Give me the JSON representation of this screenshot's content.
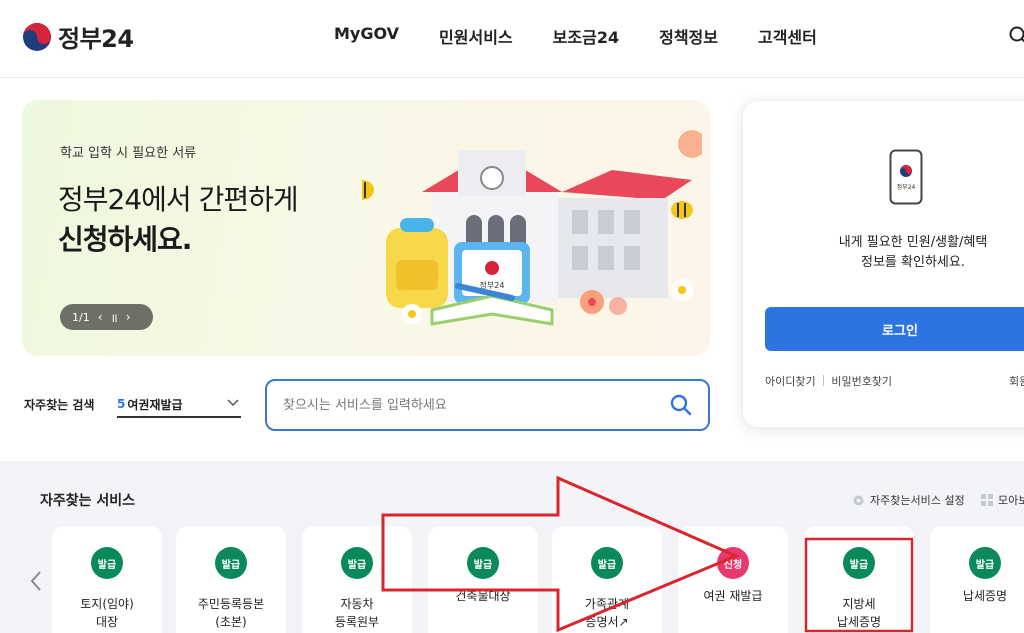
{
  "header": {
    "logo_text": "정부24",
    "nav": [
      "MyGOV",
      "민원서비스",
      "보조금24",
      "정책정보",
      "고객센터"
    ]
  },
  "banner": {
    "subtitle": "학교 입학 시 필요한 서류",
    "line1": "정부24에서 간편하게",
    "line2": "신청하세요.",
    "pager": "1/1",
    "tag_text": "정부24"
  },
  "login": {
    "badge_text": "정부24",
    "message_line1": "내게 필요한 민원/생활/혜택",
    "message_line2": "정보를 확인하세요.",
    "button": "로그인",
    "find_id": "아이디찾기",
    "find_pw": "비밀번호찾기",
    "join": "회원"
  },
  "search": {
    "quick_label": "자주찾는 검색",
    "quick_number": "5",
    "quick_value": "여권재발급",
    "placeholder": "찾으시는 서비스를 입력하세요"
  },
  "services": {
    "title": "자주찾는 서비스",
    "settings": "자주찾는서비스 설정",
    "view_all": "모아보",
    "items": [
      {
        "badge": "발급",
        "name1": "토지(임야)",
        "name2": "대장"
      },
      {
        "badge": "발급",
        "name1": "주민등록등본",
        "name2": "(초본)"
      },
      {
        "badge": "발급",
        "name1": "자동차",
        "name2": "등록원부"
      },
      {
        "badge": "발급",
        "name1": "건축물대장",
        "name2": ""
      },
      {
        "badge": "발급",
        "name1": "가족관계",
        "name2": "증명서↗"
      },
      {
        "badge": "신청",
        "name1": "여권 재발급",
        "name2": ""
      },
      {
        "badge": "발급",
        "name1": "지방세",
        "name2": "납세증명"
      },
      {
        "badge": "발급",
        "name1": "납세증명",
        "name2": ""
      }
    ]
  },
  "colors": {
    "accent_blue": "#2d74e0",
    "badge_green": "#0a8a5b",
    "badge_pink": "#e8386e",
    "annotation_red": "#d8262e"
  }
}
